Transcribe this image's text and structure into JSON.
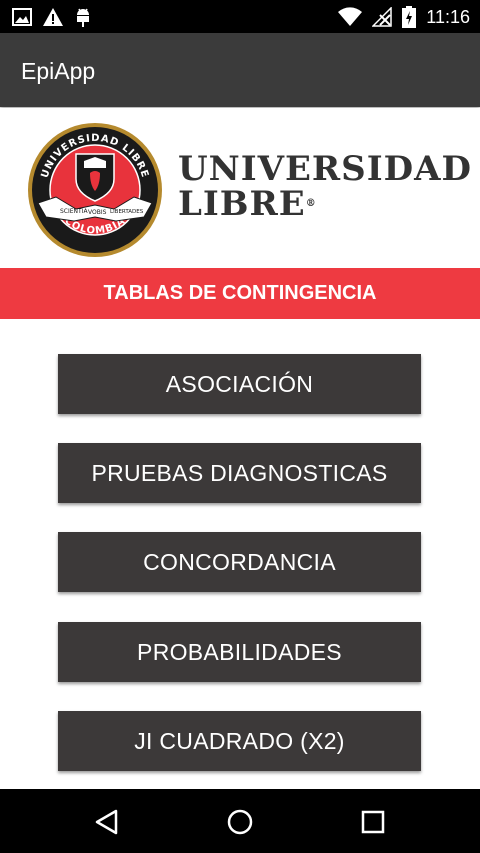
{
  "status_bar": {
    "time": "11:16",
    "icons": [
      "image-notification-icon",
      "warning-icon",
      "android-debug-icon",
      "wifi-icon",
      "no-signal-icon",
      "battery-charging-icon"
    ]
  },
  "app_bar": {
    "title": "EpiApp"
  },
  "logo": {
    "line1": "UNIVERSIDAD",
    "line2": "LIBRE",
    "seal_top": "UNIVERSIDAD LIBRE",
    "seal_bottom": "COLOMBIA",
    "seal_ribbon": [
      "SCIENTIA",
      "VOBIS",
      "LIBERTADES"
    ],
    "colors": {
      "red": "#e8333c",
      "black": "#1a1a1a"
    }
  },
  "banner": {
    "label": "TABLAS DE CONTINGENCIA",
    "color": "#ee3a41"
  },
  "menu": {
    "buttons": [
      {
        "label": "ASOCIACIÓN"
      },
      {
        "label": "PRUEBAS DIAGNOSTICAS"
      },
      {
        "label": "CONCORDANCIA"
      },
      {
        "label": "PROBABILIDADES"
      },
      {
        "label": "JI CUADRADO (X2)"
      }
    ]
  },
  "nav_bar": {
    "icons": [
      "back-icon",
      "home-icon",
      "recents-icon"
    ]
  }
}
